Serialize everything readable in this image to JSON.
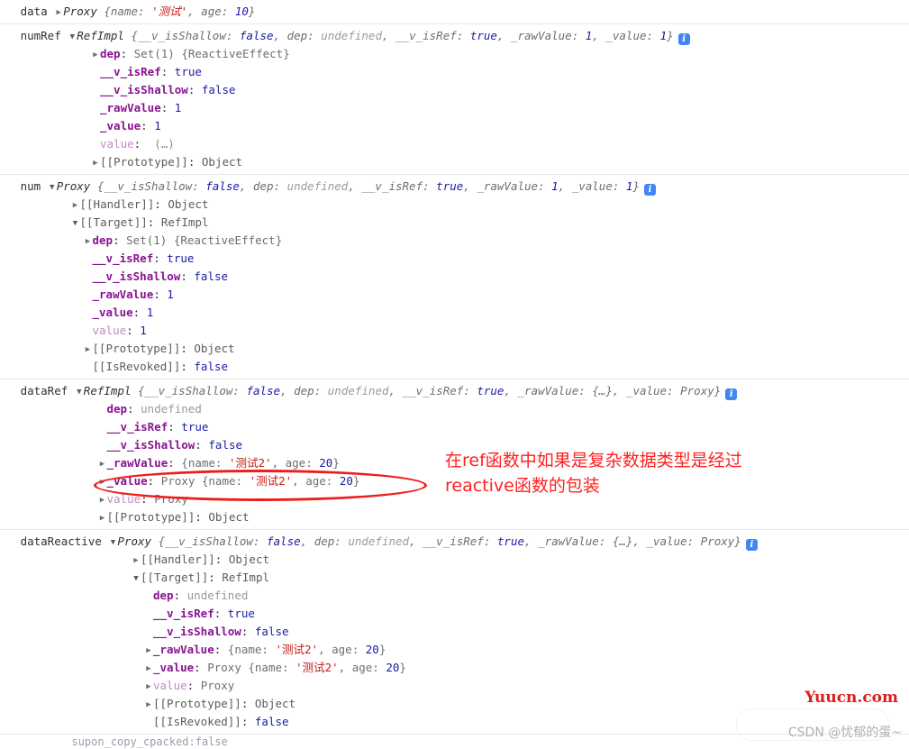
{
  "meta": {
    "app": "Chrome DevTools Console",
    "accent_blue": "#1a1aa6",
    "accent_prop": "#881391",
    "accent_string": "#c41a16",
    "annotation_red": "#ff2020",
    "info_badge_blue": "#4285f4"
  },
  "icons": {
    "triangle_closed": "▶",
    "triangle_open": "▼",
    "info": "i"
  },
  "groups": [
    {
      "label": "data",
      "header": {
        "class": "Proxy",
        "preview": "{name: '测试', age: 10}",
        "name_key": "name",
        "name_value": "'测试'",
        "age_key": "age",
        "age_value": "10",
        "expanded": false,
        "info": false
      },
      "rows": []
    },
    {
      "label": "numRef",
      "header": {
        "class": "RefImpl",
        "preview": "{__v_isShallow: false, dep: undefined, __v_isRef: true, _rawValue: 1, _value: 1}",
        "expanded": true,
        "info": true
      },
      "rows": [
        {
          "indent": 1,
          "tri": "closed",
          "key": "dep",
          "sep": ": ",
          "value": "Set(1) {ReactiveEffect}",
          "kind": "gray"
        },
        {
          "indent": 1,
          "tri": "none",
          "key": "__v_isRef",
          "sep": ": ",
          "value": "true",
          "kind": "bool"
        },
        {
          "indent": 1,
          "tri": "none",
          "key": "__v_isShallow",
          "sep": ": ",
          "value": "false",
          "kind": "bool"
        },
        {
          "indent": 1,
          "tri": "none",
          "key": "_rawValue",
          "sep": ": ",
          "value": "1",
          "kind": "num"
        },
        {
          "indent": 1,
          "tri": "none",
          "key": "_value",
          "sep": ": ",
          "value": "1",
          "kind": "num"
        },
        {
          "indent": 1,
          "tri": "none",
          "key": "value",
          "sep": ":  ",
          "value": "(…)",
          "kind": "ellip",
          "dim": true
        },
        {
          "indent": 1,
          "tri": "closed",
          "key": "[[Prototype]]",
          "sep": ": ",
          "value": "Object",
          "kind": "internal",
          "internalKey": true
        }
      ]
    },
    {
      "label": "num",
      "header": {
        "class": "Proxy",
        "preview": "{__v_isShallow: false, dep: undefined, __v_isRef: true, _rawValue: 1, _value: 1}",
        "expanded": true,
        "info": true
      },
      "rows": [
        {
          "indent": 1,
          "tri": "closed",
          "key": "[[Handler]]",
          "sep": ": ",
          "value": "Object",
          "kind": "internal",
          "internalKey": true
        },
        {
          "indent": 1,
          "tri": "open",
          "key": "[[Target]]",
          "sep": ": ",
          "value": "RefImpl",
          "kind": "internal",
          "internalKey": true
        },
        {
          "indent": 2,
          "tri": "closed",
          "key": "dep",
          "sep": ": ",
          "value": "Set(1) {ReactiveEffect}",
          "kind": "gray"
        },
        {
          "indent": 2,
          "tri": "none",
          "key": "__v_isRef",
          "sep": ": ",
          "value": "true",
          "kind": "bool"
        },
        {
          "indent": 2,
          "tri": "none",
          "key": "__v_isShallow",
          "sep": ": ",
          "value": "false",
          "kind": "bool"
        },
        {
          "indent": 2,
          "tri": "none",
          "key": "_rawValue",
          "sep": ": ",
          "value": "1",
          "kind": "num"
        },
        {
          "indent": 2,
          "tri": "none",
          "key": "_value",
          "sep": ": ",
          "value": "1",
          "kind": "num"
        },
        {
          "indent": 2,
          "tri": "none",
          "key": "value",
          "sep": ": ",
          "value": "1",
          "kind": "num",
          "dim": true
        },
        {
          "indent": 2,
          "tri": "closed",
          "key": "[[Prototype]]",
          "sep": ": ",
          "value": "Object",
          "kind": "internal",
          "internalKey": true
        },
        {
          "indent": 2,
          "tri": "none",
          "key": "[[IsRevoked]]",
          "sep": ": ",
          "value": "false",
          "kind": "bool",
          "internalKey": true
        }
      ]
    },
    {
      "label": "dataRef",
      "header": {
        "class": "RefImpl",
        "preview": "{__v_isShallow: false, dep: undefined, __v_isRef: true, _rawValue: {…}, _value: Proxy}",
        "expanded": true,
        "info": true
      },
      "rows": [
        {
          "indent": 1,
          "tri": "none",
          "key": "dep",
          "sep": ": ",
          "value": "undefined",
          "kind": "undef"
        },
        {
          "indent": 1,
          "tri": "none",
          "key": "__v_isRef",
          "sep": ": ",
          "value": "true",
          "kind": "bool"
        },
        {
          "indent": 1,
          "tri": "none",
          "key": "__v_isShallow",
          "sep": ": ",
          "value": "false",
          "kind": "bool"
        },
        {
          "indent": 1,
          "tri": "closed",
          "key": "_rawValue",
          "sep": ": ",
          "value": "{name: '测试2', age: 20}",
          "kind": "objpreview"
        },
        {
          "indent": 1,
          "tri": "closed",
          "key": "_value",
          "sep": ": ",
          "value": "Proxy {name: '测试2', age: 20}",
          "kind": "objpreview",
          "circled": true
        },
        {
          "indent": 1,
          "tri": "closed",
          "key": "value",
          "sep": ": ",
          "value": "Proxy",
          "kind": "gray",
          "dim": true
        },
        {
          "indent": 1,
          "tri": "closed",
          "key": "[[Prototype]]",
          "sep": ": ",
          "value": "Object",
          "kind": "internal",
          "internalKey": true
        }
      ]
    },
    {
      "label": "dataReactive",
      "header": {
        "class": "Proxy",
        "preview": "{__v_isShallow: false, dep: undefined, __v_isRef: true, _rawValue: {…}, _value: Proxy}",
        "expanded": true,
        "info": true
      },
      "rows": [
        {
          "indent": 1,
          "tri": "closed",
          "key": "[[Handler]]",
          "sep": ": ",
          "value": "Object",
          "kind": "internal",
          "internalKey": true
        },
        {
          "indent": 1,
          "tri": "open",
          "key": "[[Target]]",
          "sep": ": ",
          "value": "RefImpl",
          "kind": "internal",
          "internalKey": true
        },
        {
          "indent": 2,
          "tri": "none",
          "key": "dep",
          "sep": ": ",
          "value": "undefined",
          "kind": "undef"
        },
        {
          "indent": 2,
          "tri": "none",
          "key": "__v_isRef",
          "sep": ": ",
          "value": "true",
          "kind": "bool"
        },
        {
          "indent": 2,
          "tri": "none",
          "key": "__v_isShallow",
          "sep": ": ",
          "value": "false",
          "kind": "bool"
        },
        {
          "indent": 2,
          "tri": "closed",
          "key": "_rawValue",
          "sep": ": ",
          "value": "{name: '测试2', age: 20}",
          "kind": "objpreview"
        },
        {
          "indent": 2,
          "tri": "closed",
          "key": "_value",
          "sep": ": ",
          "value": "Proxy {name: '测试2', age: 20}",
          "kind": "objpreview"
        },
        {
          "indent": 2,
          "tri": "closed",
          "key": "value",
          "sep": ": ",
          "value": "Proxy",
          "kind": "gray",
          "dim": true
        },
        {
          "indent": 2,
          "tri": "closed",
          "key": "[[Prototype]]",
          "sep": ": ",
          "value": "Object",
          "kind": "internal",
          "internalKey": true
        },
        {
          "indent": 2,
          "tri": "none",
          "key": "[[IsRevoked]]",
          "sep": ": ",
          "value": "false",
          "kind": "bool",
          "internalKey": true
        }
      ]
    }
  ],
  "clipped_row": "supon_copy_cpacked:false",
  "annotation": {
    "text": "在ref函数中如果是复杂数据类型是经过\nreactive函数的包装",
    "color": "#ff2020"
  },
  "watermarks": {
    "primary": "Yuucn.com",
    "secondary": "CSDN @忧郁的蛋~"
  }
}
